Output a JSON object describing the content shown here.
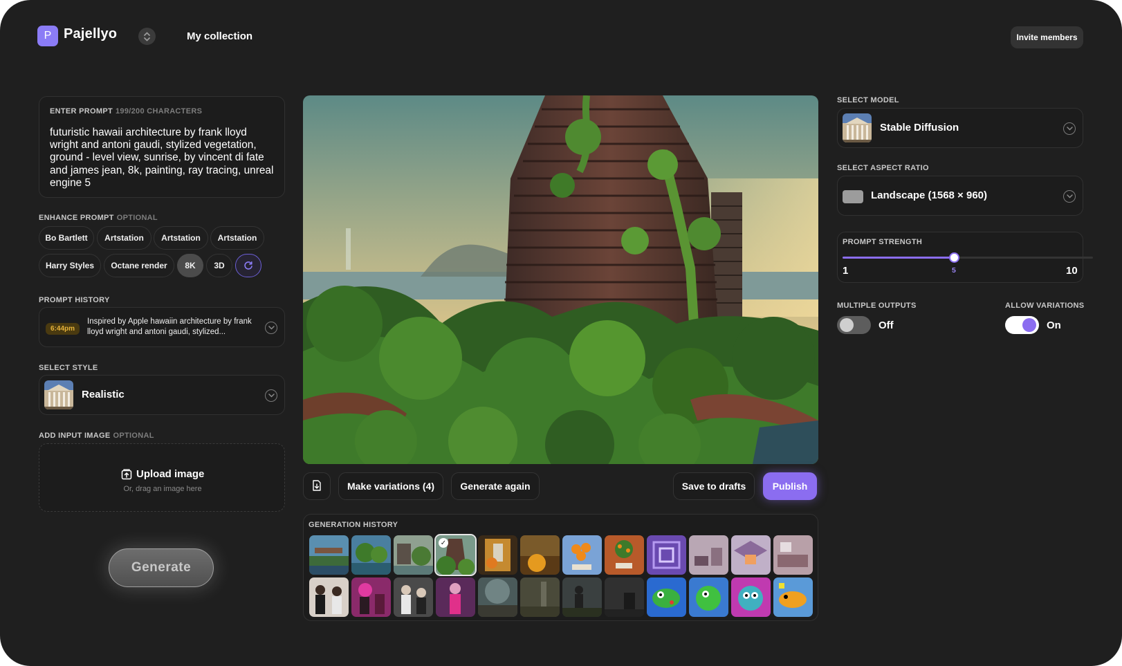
{
  "app": {
    "logo_letter": "P",
    "name": "Pajellyo"
  },
  "header": {
    "nav_link": "My collection",
    "invite_label": "Invite members"
  },
  "prompt": {
    "label": "Enter prompt",
    "counter": "199/200 characters",
    "text": "futuristic hawaii architecture by frank lloyd wright and antoni gaudi, stylized vegetation, ground - level view, sunrise, by vincent di fate and james jean, 8k, painting, ray tracing, unreal engine 5"
  },
  "enhance": {
    "label": "Enhance prompt",
    "optional": "optional",
    "chips": [
      "Bo Bartlett",
      "Artstation",
      "Artstation",
      "Artstation",
      "Harry Styles",
      "Octane render",
      "8K",
      "3D"
    ],
    "active_chip": "8K",
    "refresh_icon": "refresh-icon"
  },
  "prompt_history": {
    "label": "Prompt history",
    "time": "6:44pm",
    "text": "Inspired by Apple hawaiin architecture by frank lloyd wright and antoni gaudi, stylized..."
  },
  "style": {
    "label": "Select style",
    "value": "Realistic"
  },
  "input_image": {
    "label": "Add input image",
    "optional": "optional",
    "upload_label": "Upload image",
    "upload_hint": "Or, drag an image here"
  },
  "generate_label": "Generate",
  "actions": {
    "export_icon": "file-download-icon",
    "variations": "Make variations (4)",
    "again": "Generate again",
    "drafts": "Save to drafts",
    "publish": "Publish"
  },
  "generation_history": {
    "label": "Generation history",
    "selected_index": 3
  },
  "model": {
    "label": "Select model",
    "value": "Stable Diffusion"
  },
  "aspect": {
    "label": "Select aspect ratio",
    "value": "Landscape (1568 × 960)"
  },
  "strength": {
    "label": "Prompt strength",
    "min": "1",
    "value": "5",
    "max": "10",
    "fraction": 0.444
  },
  "multiple_outputs": {
    "label": "Multiple outputs",
    "state": "Off"
  },
  "allow_variations": {
    "label": "Allow variations",
    "state": "On"
  },
  "colors": {
    "accent": "#8b6df0",
    "background": "#1f1f1f",
    "card_border": "#313131"
  }
}
